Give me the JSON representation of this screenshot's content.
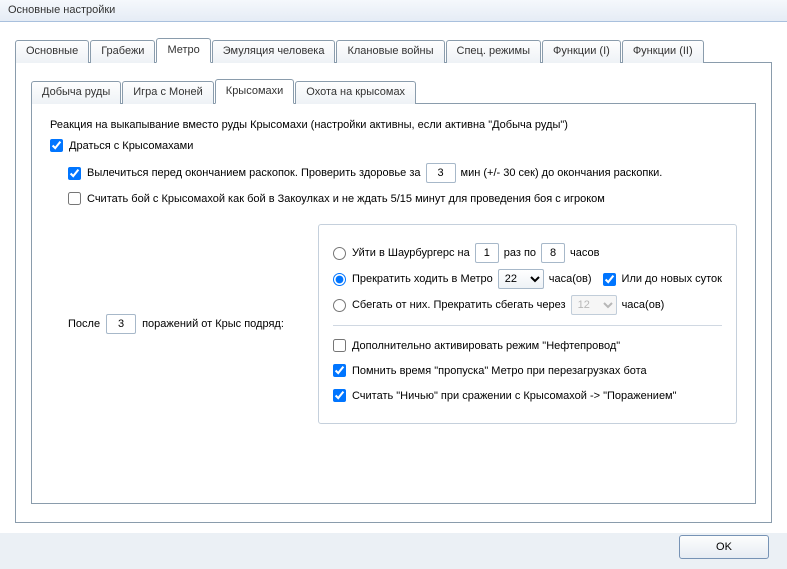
{
  "window": {
    "title": "Основные настройки"
  },
  "tabs": {
    "main": [
      "Основные",
      "Грабежи",
      "Метро",
      "Эмуляция человека",
      "Клановые войны",
      "Спец. режимы",
      "Функции (I)",
      "Функции (II)"
    ],
    "main_active": 2,
    "metro": [
      "Добыча руды",
      "Игра с Моней",
      "Крысомахи",
      "Охота на крысомах"
    ],
    "metro_active": 2
  },
  "panel": {
    "heading": "Реакция на выкапывание вместо руды Крысомахи  (настройки активны, если активна \"Добыча руды\")",
    "fight_label": "Драться с Крысомахами",
    "fight_checked": true,
    "heal_label_pre": "Вылечиться перед окончанием раскопок. Проверить здоровье за",
    "heal_value": "3",
    "heal_label_post": "мин (+/- 30 сек) до окончания раскопки.",
    "heal_checked": true,
    "count_alley_label": "Считать бой с Крысомахой как бой в Закоулках и не ждать 5/15 минут для проведения боя с игроком",
    "count_alley_checked": false,
    "after_label_pre": "После",
    "after_value": "3",
    "after_label_post": "поражений от Крыс подряд:",
    "opt1_label_pre": "Уйти в Шаурбургерс на",
    "opt1_times": "1",
    "opt1_mid": "раз по",
    "opt1_hours": "8",
    "opt1_post": "часов",
    "opt2_label_pre": "Прекратить ходить в Метро",
    "opt2_hours": "22",
    "opt2_post": "часа(ов)",
    "opt2_or_label": "Или до новых суток",
    "opt2_or_checked": true,
    "opt3_label_pre": "Сбегать от них. Прекратить сбегать через",
    "opt3_hours": "12",
    "opt3_post": "часа(ов)",
    "selected_radio": 1,
    "extra1_label": "Дополнительно активировать режим \"Нефтепровод\"",
    "extra1_checked": false,
    "extra2_label": "Помнить время \"пропуска\" Метро при перезагрузках бота",
    "extra2_checked": true,
    "extra3_label": "Считать \"Ничью\" при сражении с Крысомахой -> \"Поражением\"",
    "extra3_checked": true
  },
  "footer": {
    "ok": "OK"
  }
}
